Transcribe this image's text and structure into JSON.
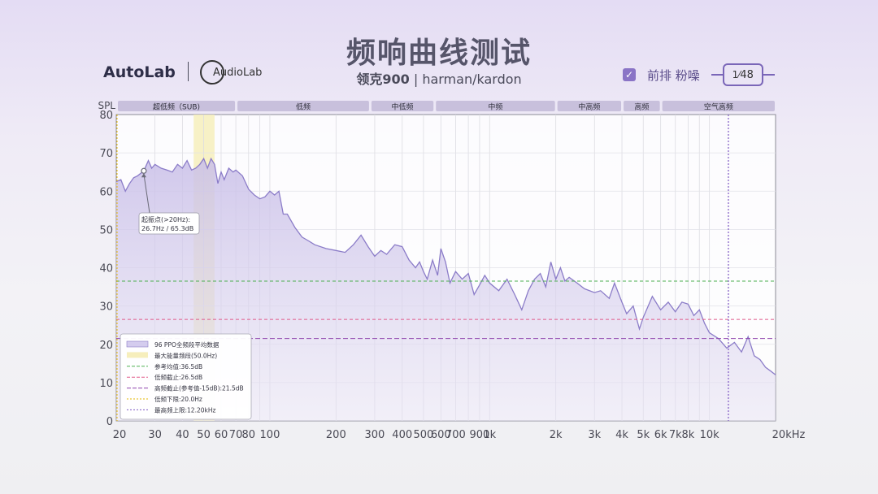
{
  "header": {
    "title": "频响曲线测试",
    "product_name": "领克900",
    "divider": "|",
    "brand": "harman/kardon"
  },
  "logos": {
    "left": "AutoLab",
    "right": "AudioLab"
  },
  "controls": {
    "checkbox_checked": true,
    "mode_label": "前排 粉噪",
    "page_current": "1",
    "page_total": "48"
  },
  "colors": {
    "accent": "#8a74c6",
    "curve": "#8b7cc8",
    "band_header": "#c8c0dc",
    "energy_band": "#f6eebc",
    "mean_line": "#4caf50",
    "low_cut_line": "#e05a8a",
    "high_cut_line": "#8e44ad",
    "low_limit_line": "#e6b800",
    "high_limit_line": "#7e57c2"
  },
  "chart_data": {
    "type": "area",
    "y_axis_label": "SPL",
    "ylim": [
      0,
      80
    ],
    "y_ticks": [
      0,
      10,
      20,
      30,
      40,
      50,
      60,
      70,
      80
    ],
    "xlim": [
      20,
      20000
    ],
    "x_scale": "log",
    "x_ticks": [
      {
        "value": 20,
        "label": "20"
      },
      {
        "value": 30,
        "label": "30"
      },
      {
        "value": 40,
        "label": "40"
      },
      {
        "value": 50,
        "label": "50"
      },
      {
        "value": 60,
        "label": "60"
      },
      {
        "value": 70,
        "label": "70"
      },
      {
        "value": 80,
        "label": "80"
      },
      {
        "value": 100,
        "label": "100"
      },
      {
        "value": 200,
        "label": "200"
      },
      {
        "value": 300,
        "label": "300"
      },
      {
        "value": 400,
        "label": "400"
      },
      {
        "value": 500,
        "label": "500"
      },
      {
        "value": 600,
        "label": "600"
      },
      {
        "value": 700,
        "label": "700"
      },
      {
        "value": 900,
        "label": "900"
      },
      {
        "value": 1000,
        "label": "1k"
      },
      {
        "value": 2000,
        "label": "2k"
      },
      {
        "value": 3000,
        "label": "3k"
      },
      {
        "value": 4000,
        "label": "4k"
      },
      {
        "value": 5000,
        "label": "5k"
      },
      {
        "value": 6000,
        "label": "6k"
      },
      {
        "value": 7000,
        "label": "7k"
      },
      {
        "value": 8000,
        "label": "8k"
      },
      {
        "value": 10000,
        "label": "10k"
      },
      {
        "value": 20000,
        "label": "20kHz"
      }
    ],
    "bands": [
      {
        "label": "超低频（SUB)",
        "from": 20,
        "to": 70
      },
      {
        "label": "低频",
        "from": 70,
        "to": 285
      },
      {
        "label": "中低频",
        "from": 285,
        "to": 560
      },
      {
        "label": "中频",
        "from": 560,
        "to": 2000
      },
      {
        "label": "中高频",
        "from": 2000,
        "to": 4000
      },
      {
        "label": "高频",
        "from": 4000,
        "to": 6000
      },
      {
        "label": "空气高频",
        "from": 6000,
        "to": 20000
      }
    ],
    "energy_band": {
      "from": 45,
      "to": 56
    },
    "reference_lines": {
      "mean": 36.5,
      "low_cut": 26.5,
      "high_cut": 21.5,
      "low_limit_hz": 20.0,
      "high_limit_hz": 12200
    },
    "annotation": {
      "x": 26.7,
      "y": 65.3,
      "line1": "起振点(>20Hz):",
      "line2": "26.7Hz / 65.3dB"
    },
    "legend": {
      "position": "bottom-left",
      "items": [
        {
          "label": "96 PPO全频段平均数据",
          "style": "curve"
        },
        {
          "label": "最大能量频段(50.0Hz)",
          "style": "energy"
        },
        {
          "label": "参考均值:36.5dB",
          "style": "mean"
        },
        {
          "label": "低频截止:26.5dB",
          "style": "low_cut"
        },
        {
          "label": "高频截止(参考值-15dB):21.5dB",
          "style": "high_cut"
        },
        {
          "label": "低频下限:20.0Hz",
          "style": "low_limit"
        },
        {
          "label": "最高频上限:12.20kHz",
          "style": "high_limit"
        }
      ]
    },
    "series": [
      {
        "name": "96 PPO全频段平均数据",
        "x": [
          20,
          21,
          22,
          23,
          24,
          25,
          26.7,
          28,
          29,
          30,
          32,
          34,
          36,
          38,
          40,
          42,
          44,
          46,
          48,
          50,
          52,
          54,
          56,
          58,
          60,
          62,
          65,
          68,
          70,
          75,
          80,
          85,
          90,
          95,
          100,
          105,
          110,
          115,
          120,
          130,
          140,
          150,
          160,
          180,
          200,
          220,
          240,
          260,
          280,
          300,
          320,
          340,
          370,
          400,
          430,
          460,
          480,
          500,
          520,
          550,
          580,
          600,
          630,
          660,
          700,
          750,
          800,
          850,
          900,
          950,
          1000,
          1100,
          1200,
          1300,
          1400,
          1500,
          1600,
          1700,
          1800,
          1900,
          2000,
          2100,
          2200,
          2300,
          2500,
          2700,
          3000,
          3200,
          3500,
          3700,
          4000,
          4200,
          4500,
          4800,
          5000,
          5500,
          6000,
          6500,
          7000,
          7500,
          8000,
          8500,
          9000,
          9500,
          10000,
          11000,
          12000,
          13000,
          14000,
          15000,
          16000,
          17000,
          18000,
          19000,
          20000
        ],
        "y": [
          62.5,
          63,
          60,
          62,
          63.5,
          64,
          65.3,
          68,
          66,
          67,
          66,
          65.5,
          65,
          67,
          66,
          68,
          65.5,
          66,
          67,
          68.5,
          66,
          68.5,
          67,
          62,
          65,
          63,
          66,
          65,
          65.5,
          64,
          60.5,
          59,
          58,
          58.5,
          60,
          59,
          60,
          54,
          54,
          50.5,
          48,
          47,
          46,
          45,
          44.5,
          44,
          46,
          48.5,
          45.5,
          43,
          44.5,
          43.5,
          46,
          45.5,
          42,
          40,
          41.5,
          39,
          37,
          42,
          38,
          45,
          41.5,
          36,
          39,
          37,
          38.5,
          33,
          35.5,
          38,
          36,
          34,
          37,
          33,
          29,
          34,
          37,
          38.5,
          35,
          41.5,
          37,
          40,
          36.5,
          37.5,
          36,
          34.5,
          33.5,
          34,
          32,
          36,
          31,
          28,
          30,
          24,
          27,
          32.5,
          29,
          31,
          28.5,
          31,
          30.5,
          27.5,
          29,
          25.5,
          23,
          21.5,
          19,
          20.5,
          18,
          22,
          17,
          16,
          14,
          13,
          12
        ]
      }
    ]
  }
}
